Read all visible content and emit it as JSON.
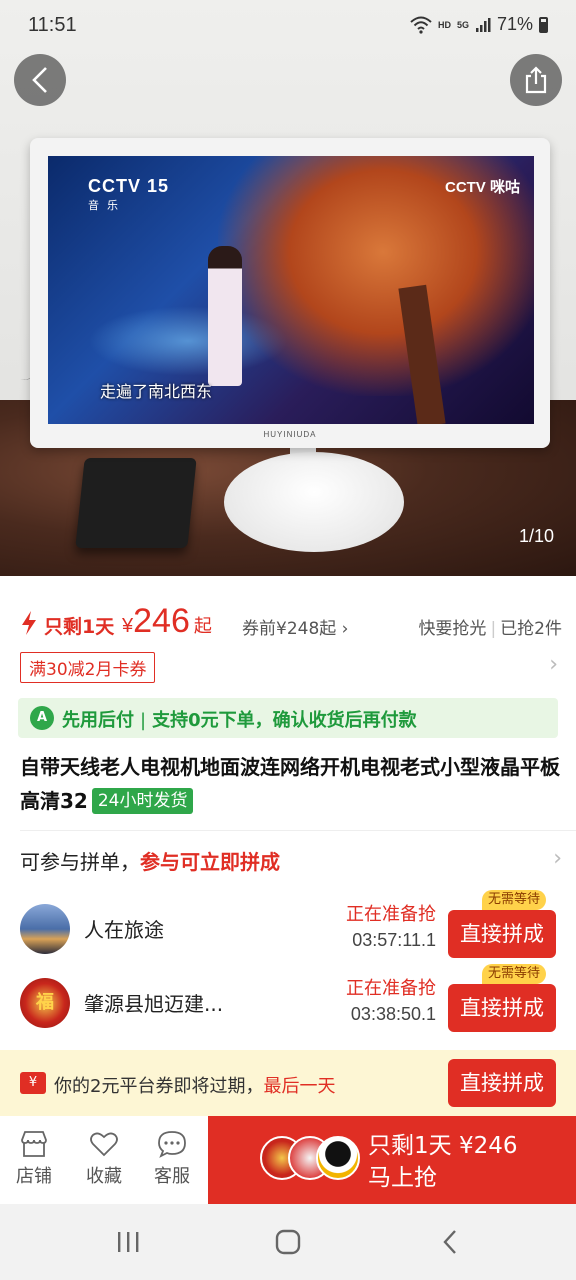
{
  "status_bar": {
    "time": "11:51",
    "hd": "HD",
    "signal": "5G",
    "battery": "71%"
  },
  "hero": {
    "page_counter": "1/10",
    "screen_logo_left": "CCTV 15",
    "screen_logo_left_sub": "音乐",
    "screen_logo_right": "CCTV 咪咕",
    "screen_subtitle": "走遍了南北西东",
    "monitor_brand": "HUYINIUDA"
  },
  "price_row": {
    "only_left": "只剩1天",
    "currency": "¥",
    "price": "246",
    "suffix": "起",
    "pre_coupon": "券前¥248起",
    "sell_status": "快要抢光",
    "sold": "已抢2件"
  },
  "coupon": {
    "label": "满30减2月卡券"
  },
  "pay_later": {
    "title": "先用后付",
    "desc": "支持0元下单，确认收货后再付款"
  },
  "product": {
    "title": "自带天线老人电视机地面波连网络开机电视老式小型液晶平板高清32",
    "ship_badge": "24小时发货"
  },
  "group_section": {
    "head_text": "可参与拼单，",
    "head_highlight": "参与可立即拼成",
    "groups": [
      {
        "name": "人在旅途",
        "state": "正在准备抢",
        "countdown": "03:57:11.1",
        "button": "直接拼成",
        "badge": "无需等待",
        "avatar_text": ""
      },
      {
        "name": "肇源县旭迈建...",
        "state": "正在准备抢",
        "countdown": "03:38:50.1",
        "button": "直接拼成",
        "badge": "无需等待",
        "avatar_text": "福"
      }
    ]
  },
  "expire_bar": {
    "icon": "¥",
    "text": "你的2元平台券即将过期，",
    "highlight": "最后一天",
    "button": "直接拼成"
  },
  "bottom_bar": {
    "store": "店铺",
    "favorite": "收藏",
    "service": "客服",
    "buy_line1": "只剩1天 ¥246",
    "buy_line2": "马上抢"
  },
  "colors": {
    "accent": "#e02e24",
    "green": "#2fa74a",
    "warn_bg": "#fdf6d4"
  },
  "icons": [
    "back-arrow-icon",
    "share-icon",
    "lightning-icon",
    "chevron-right-icon",
    "store-icon",
    "heart-icon",
    "chat-icon",
    "recent-apps-icon",
    "home-icon",
    "back-icon"
  ]
}
